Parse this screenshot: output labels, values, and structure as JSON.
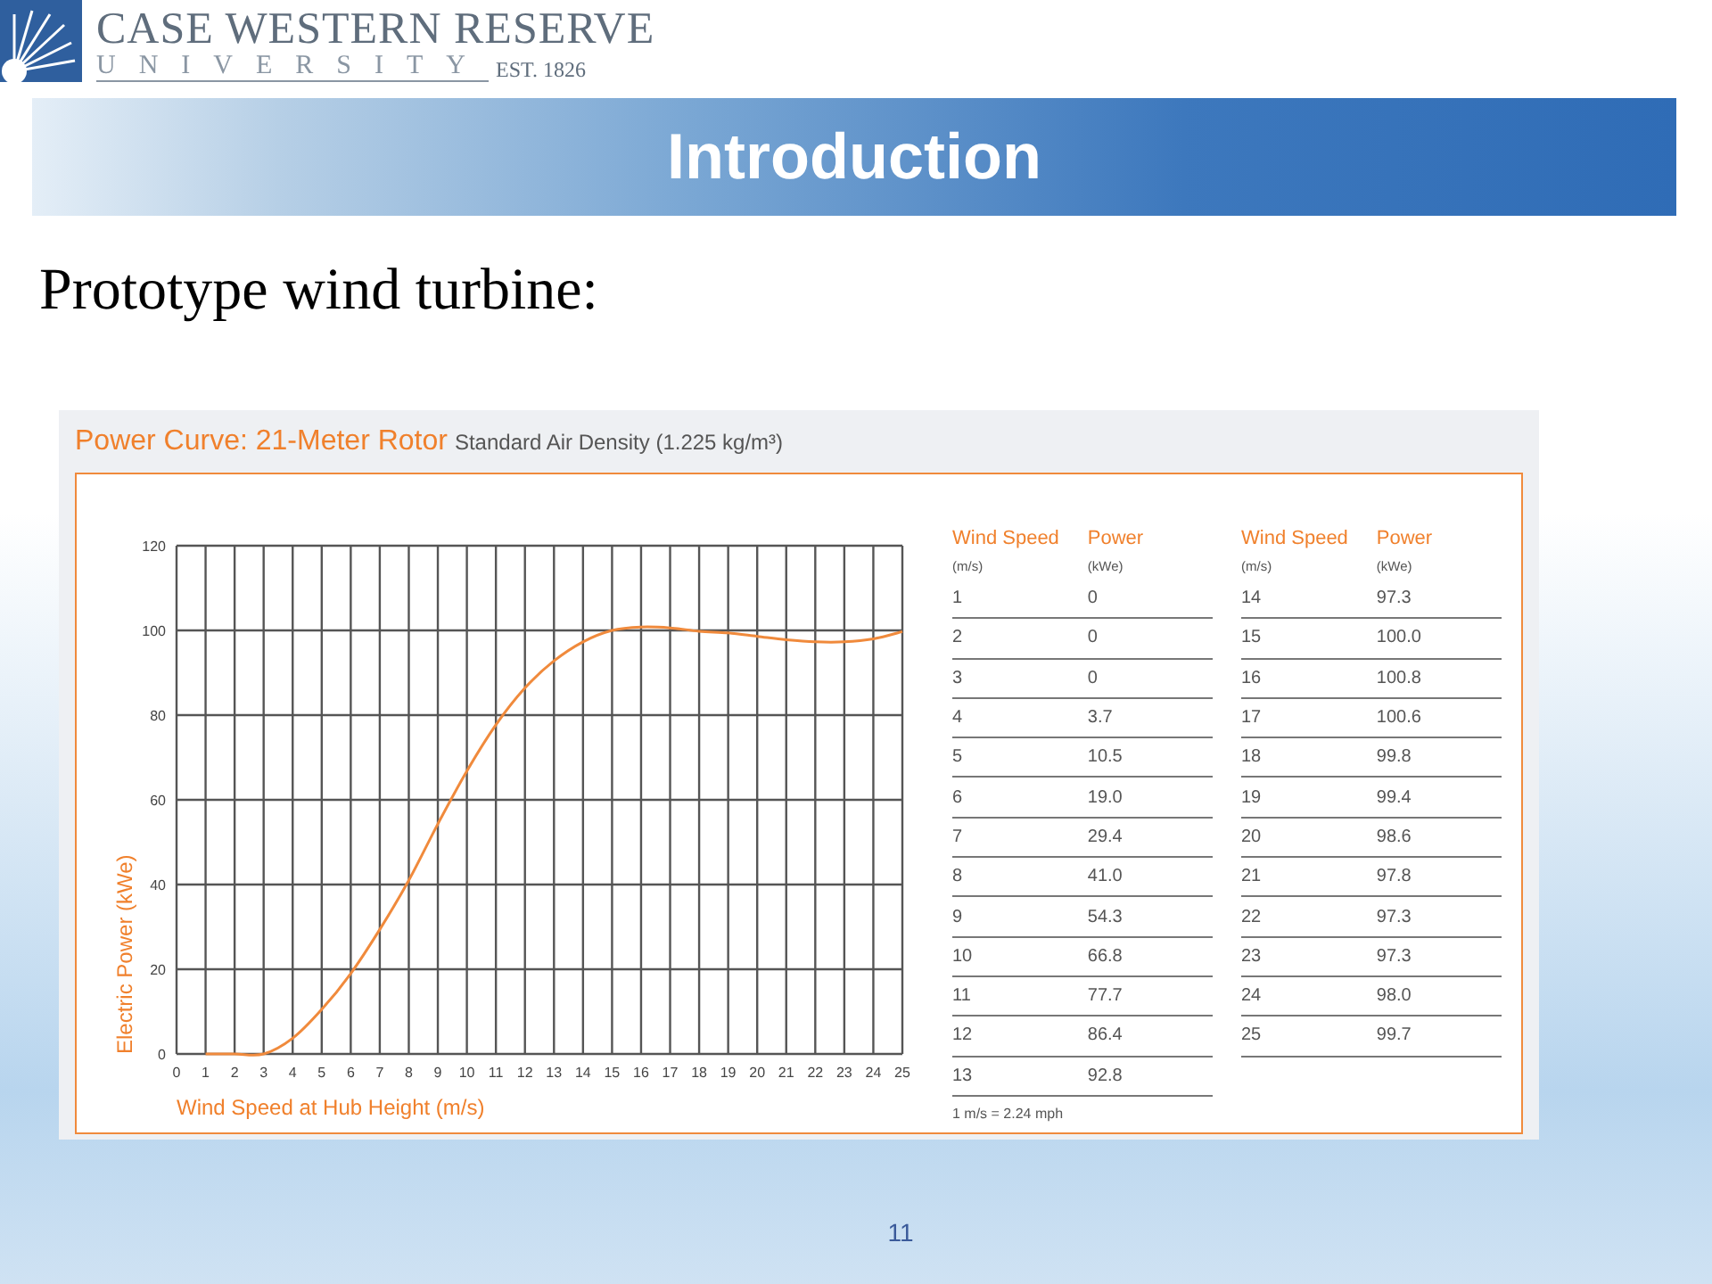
{
  "header": {
    "logo": {
      "name_line": "CASE WESTERN RESERVE",
      "university_line": "UNIVERSITY",
      "established": "EST. 1826"
    }
  },
  "banner": {
    "title": "Introduction"
  },
  "heading": "Prototype wind turbine:",
  "figure": {
    "title": "Power Curve: 21-Meter Rotor",
    "subtitle": "Standard Air Density (1.225 kg/m³)",
    "chart_data": {
      "type": "line",
      "xlabel": "Wind Speed at Hub Height (m/s)",
      "ylabel": "Electric Power (kWe)",
      "x": [
        1,
        2,
        3,
        4,
        5,
        6,
        7,
        8,
        9,
        10,
        11,
        12,
        13,
        14,
        15,
        16,
        17,
        18,
        19,
        20,
        21,
        22,
        23,
        24,
        25
      ],
      "series": [
        {
          "color": "#f08a3c",
          "values": [
            0,
            0,
            0,
            3.7,
            10.5,
            19.0,
            29.4,
            41.0,
            54.3,
            66.8,
            77.7,
            86.4,
            92.8,
            97.3,
            100.0,
            100.8,
            100.6,
            99.8,
            99.4,
            98.6,
            97.8,
            97.3,
            97.3,
            98.0,
            99.7
          ]
        }
      ],
      "xlim": [
        0,
        25
      ],
      "ylim": [
        0,
        120
      ],
      "xticks": [
        0,
        1,
        2,
        3,
        4,
        5,
        6,
        7,
        8,
        9,
        10,
        11,
        12,
        13,
        14,
        15,
        16,
        17,
        18,
        19,
        20,
        21,
        22,
        23,
        24,
        25
      ],
      "yticks": [
        0,
        20,
        40,
        60,
        80,
        100,
        120
      ],
      "grid": true
    },
    "tables": [
      {
        "columns": [
          {
            "label": "Wind Speed",
            "unit": "(m/s)"
          },
          {
            "label": "Power",
            "unit": "(kWe)"
          }
        ],
        "rows": [
          [
            "1",
            "0"
          ],
          [
            "2",
            "0"
          ],
          [
            "3",
            "0"
          ],
          [
            "4",
            "3.7"
          ],
          [
            "5",
            "10.5"
          ],
          [
            "6",
            "19.0"
          ],
          [
            "7",
            "29.4"
          ],
          [
            "8",
            "41.0"
          ],
          [
            "9",
            "54.3"
          ],
          [
            "10",
            "66.8"
          ],
          [
            "11",
            "77.7"
          ],
          [
            "12",
            "86.4"
          ],
          [
            "13",
            "92.8"
          ]
        ]
      },
      {
        "columns": [
          {
            "label": "Wind Speed",
            "unit": "(m/s)"
          },
          {
            "label": "Power",
            "unit": "(kWe)"
          }
        ],
        "rows": [
          [
            "14",
            "97.3"
          ],
          [
            "15",
            "100.0"
          ],
          [
            "16",
            "100.8"
          ],
          [
            "17",
            "100.6"
          ],
          [
            "18",
            "99.8"
          ],
          [
            "19",
            "99.4"
          ],
          [
            "20",
            "98.6"
          ],
          [
            "21",
            "97.8"
          ],
          [
            "22",
            "97.3"
          ],
          [
            "23",
            "97.3"
          ],
          [
            "24",
            "98.0"
          ],
          [
            "25",
            "99.7"
          ]
        ]
      }
    ],
    "footnote": "1 m/s = 2.24 mph"
  },
  "page_number": "11"
}
